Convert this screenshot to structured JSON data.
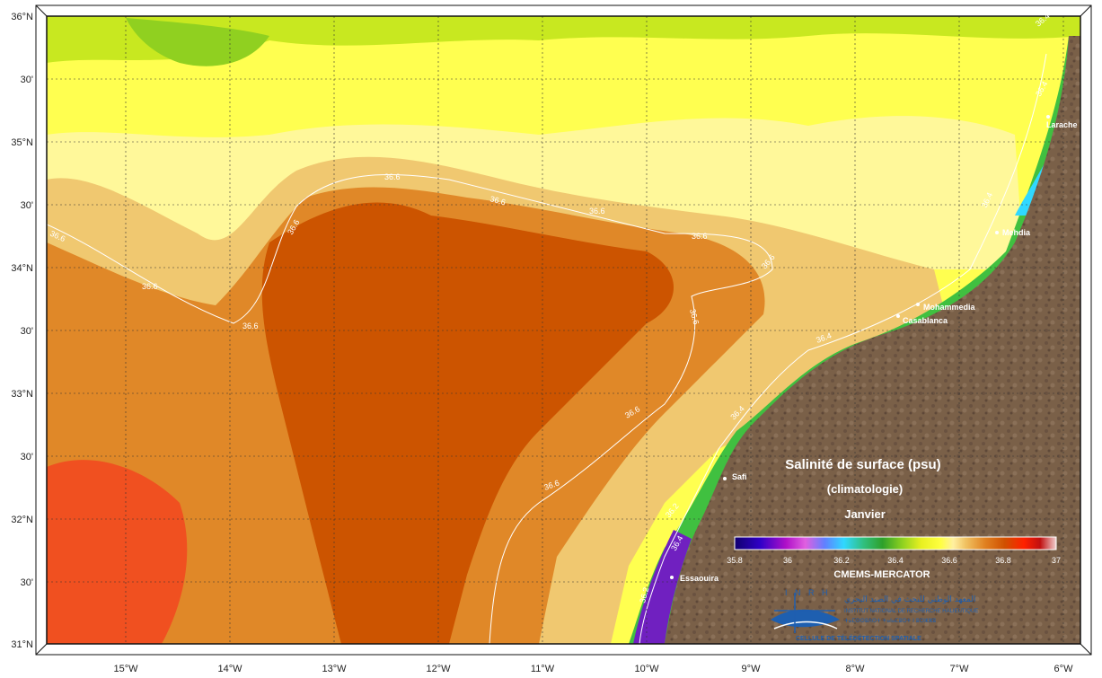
{
  "map": {
    "title": "Salinité de surface (psu)",
    "subtitle": "(climatologie)",
    "month": "Janvier",
    "source": "CMEMS-MERCATOR",
    "lat_labels": [
      "36°N",
      "30'",
      "35°N",
      "30'",
      "34°N",
      "30'",
      "33°N",
      "30'",
      "32°N",
      "30'",
      "31°N"
    ],
    "lon_labels": [
      "15°W",
      "14°W",
      "13°W",
      "12°W",
      "11°W",
      "10°W",
      "9°W",
      "8°W",
      "7°W",
      "6°W"
    ],
    "cities": [
      {
        "name": "Larache"
      },
      {
        "name": "Mehdia"
      },
      {
        "name": "Mohammedia"
      },
      {
        "name": "Casablanca"
      },
      {
        "name": "Safi"
      },
      {
        "name": "Essaouira"
      }
    ],
    "isolines": [
      "36.6",
      "36.6",
      "36.6",
      "36.6",
      "36.6",
      "36.6",
      "36.6",
      "36.6",
      "36.6",
      "36.6",
      "36.6",
      "36.6",
      "36.4",
      "36.4",
      "36.4",
      "36.4",
      "36.4",
      "36.2",
      "36.4",
      "36.2"
    ],
    "colorbar": {
      "ticks": [
        "35.8",
        "36",
        "36.2",
        "36.4",
        "36.6",
        "36.8",
        "37"
      ]
    },
    "logo": {
      "acronym": "I N R H",
      "arabic": "المعهد الوطني للبحث في الصيد البحري",
      "french": "INSTITUT NATIONAL DE RECHERCHE HALIEUTIQUE",
      "tifinagh": "ⵜⴰⵎⵙⵙⵓⴷⵙⵜ ⵜⴰⵏⴰⵎⵓⵔⵜ ⵏ ⵓⵔⵣⵣⵓ",
      "unit": "CELLULE DE TÉLÉDÉTECTION SPATIALE"
    },
    "colors": {
      "land": "#7a6048",
      "frame": "#111111"
    }
  }
}
